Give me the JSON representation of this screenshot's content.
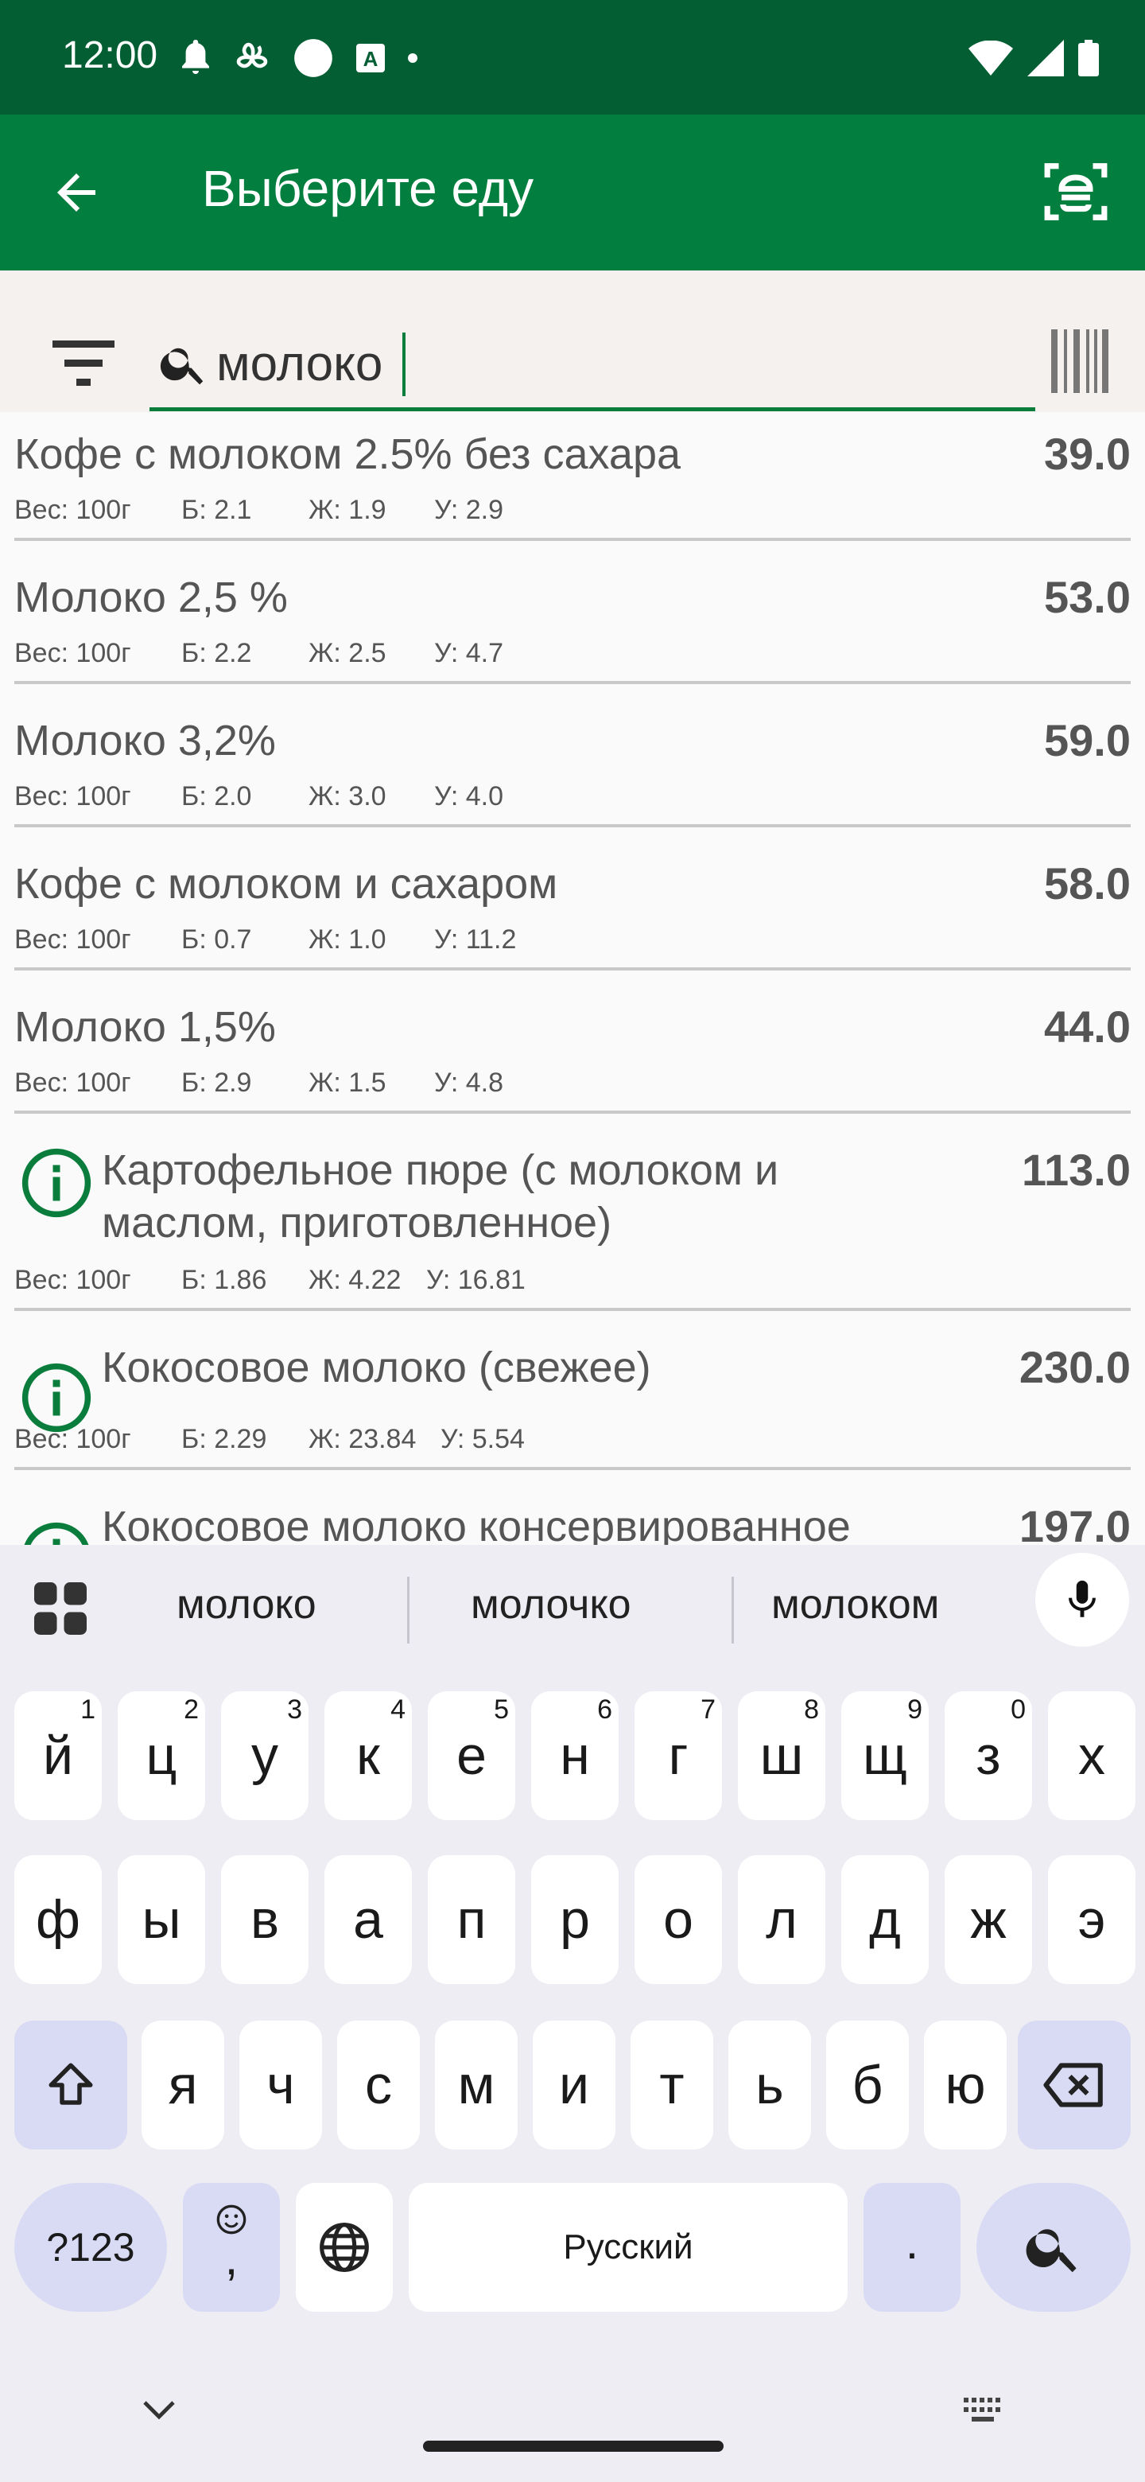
{
  "status_bar": {
    "time": "12:00",
    "icons_left": [
      "bell-icon",
      "fan-icon",
      "circle-icon",
      "font-icon",
      "dot-icon"
    ],
    "icons_right": [
      "wifi-icon",
      "signal-icon",
      "battery-icon"
    ]
  },
  "app_bar": {
    "title": "Выберите еду"
  },
  "search": {
    "query": "молоко"
  },
  "foods": [
    {
      "name": "Кофе с молоком 2.5% без сахара",
      "kcal": "39.0",
      "weight": "Вес: 100г",
      "protein": "Б: 2.1",
      "fat": "Ж: 1.9",
      "carbs": "У: 2.9",
      "info": false
    },
    {
      "name": "Молоко 2,5 %",
      "kcal": "53.0",
      "weight": "Вес: 100г",
      "protein": "Б: 2.2",
      "fat": "Ж: 2.5",
      "carbs": "У: 4.7",
      "info": false
    },
    {
      "name": "Молоко 3,2%",
      "kcal": "59.0",
      "weight": "Вес: 100г",
      "protein": "Б: 2.0",
      "fat": "Ж: 3.0",
      "carbs": "У: 4.0",
      "info": false
    },
    {
      "name": "Кофе с молоком и сахаром",
      "kcal": "58.0",
      "weight": "Вес: 100г",
      "protein": "Б: 0.7",
      "fat": "Ж: 1.0",
      "carbs": "У: 11.2",
      "info": false
    },
    {
      "name": "Молоко 1,5%",
      "kcal": "44.0",
      "weight": "Вес: 100г",
      "protein": "Б: 2.9",
      "fat": "Ж: 1.5",
      "carbs": "У: 4.8",
      "info": false
    },
    {
      "name": "Картофельное пюре (с молоком и маслом, приготовленное)",
      "kcal": "113.0",
      "weight": "Вес: 100г",
      "protein": "Б: 1.86",
      "fat": "Ж: 4.22",
      "carbs": "У: 16.81",
      "info": true
    },
    {
      "name": "Кокосовое молоко (свежее)",
      "kcal": "230.0",
      "weight": "Вес: 100г",
      "protein": "Б: 2.29",
      "fat": "Ж: 23.84",
      "carbs": "У: 5.54",
      "info": true
    },
    {
      "name": "Кокосовое молоко консервированное",
      "kcal": "197.0",
      "info": true
    }
  ],
  "keyboard": {
    "suggestions": [
      "молоко",
      "молочко",
      "молоком"
    ],
    "row1": [
      "й",
      "ц",
      "у",
      "к",
      "е",
      "н",
      "г",
      "ш",
      "щ",
      "з",
      "х"
    ],
    "row1_hints": [
      "1",
      "2",
      "3",
      "4",
      "5",
      "6",
      "7",
      "8",
      "9",
      "0",
      ""
    ],
    "row2": [
      "ф",
      "ы",
      "в",
      "а",
      "п",
      "р",
      "о",
      "л",
      "д",
      "ж",
      "э"
    ],
    "row3": [
      "я",
      "ч",
      "с",
      "м",
      "и",
      "т",
      "ь",
      "б",
      "ю"
    ],
    "symbols_label": "?123",
    "comma_label": ",",
    "space_label": "Русский",
    "period_label": "."
  }
}
